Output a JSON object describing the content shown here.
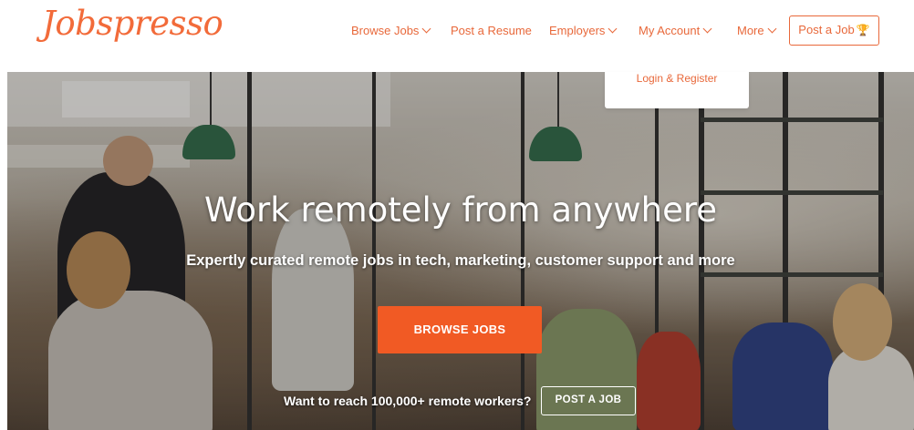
{
  "brand": {
    "logo_text": "Jobspresso",
    "accent": "#e8683a",
    "cta_color": "#f15a24"
  },
  "nav": {
    "items": [
      {
        "label": "Browse Jobs",
        "has_dropdown": true
      },
      {
        "label": "Post a Resume",
        "has_dropdown": false
      },
      {
        "label": "Employers",
        "has_dropdown": true
      },
      {
        "label": "My Account",
        "has_dropdown": true
      },
      {
        "label": "More",
        "has_dropdown": true
      }
    ],
    "post_job_label": "Post a Job",
    "post_job_icon": "trophy-icon"
  },
  "dropdown": {
    "items": [
      {
        "label": "Login & Register"
      }
    ]
  },
  "hero": {
    "title": "Work remotely from anywhere",
    "subtitle": "Expertly curated remote jobs in tech, marketing, customer support and more",
    "browse_label": "BROWSE JOBS",
    "reach_text": "Want to reach 100,000+ remote workers?",
    "post_job_label": "POST A JOB"
  }
}
